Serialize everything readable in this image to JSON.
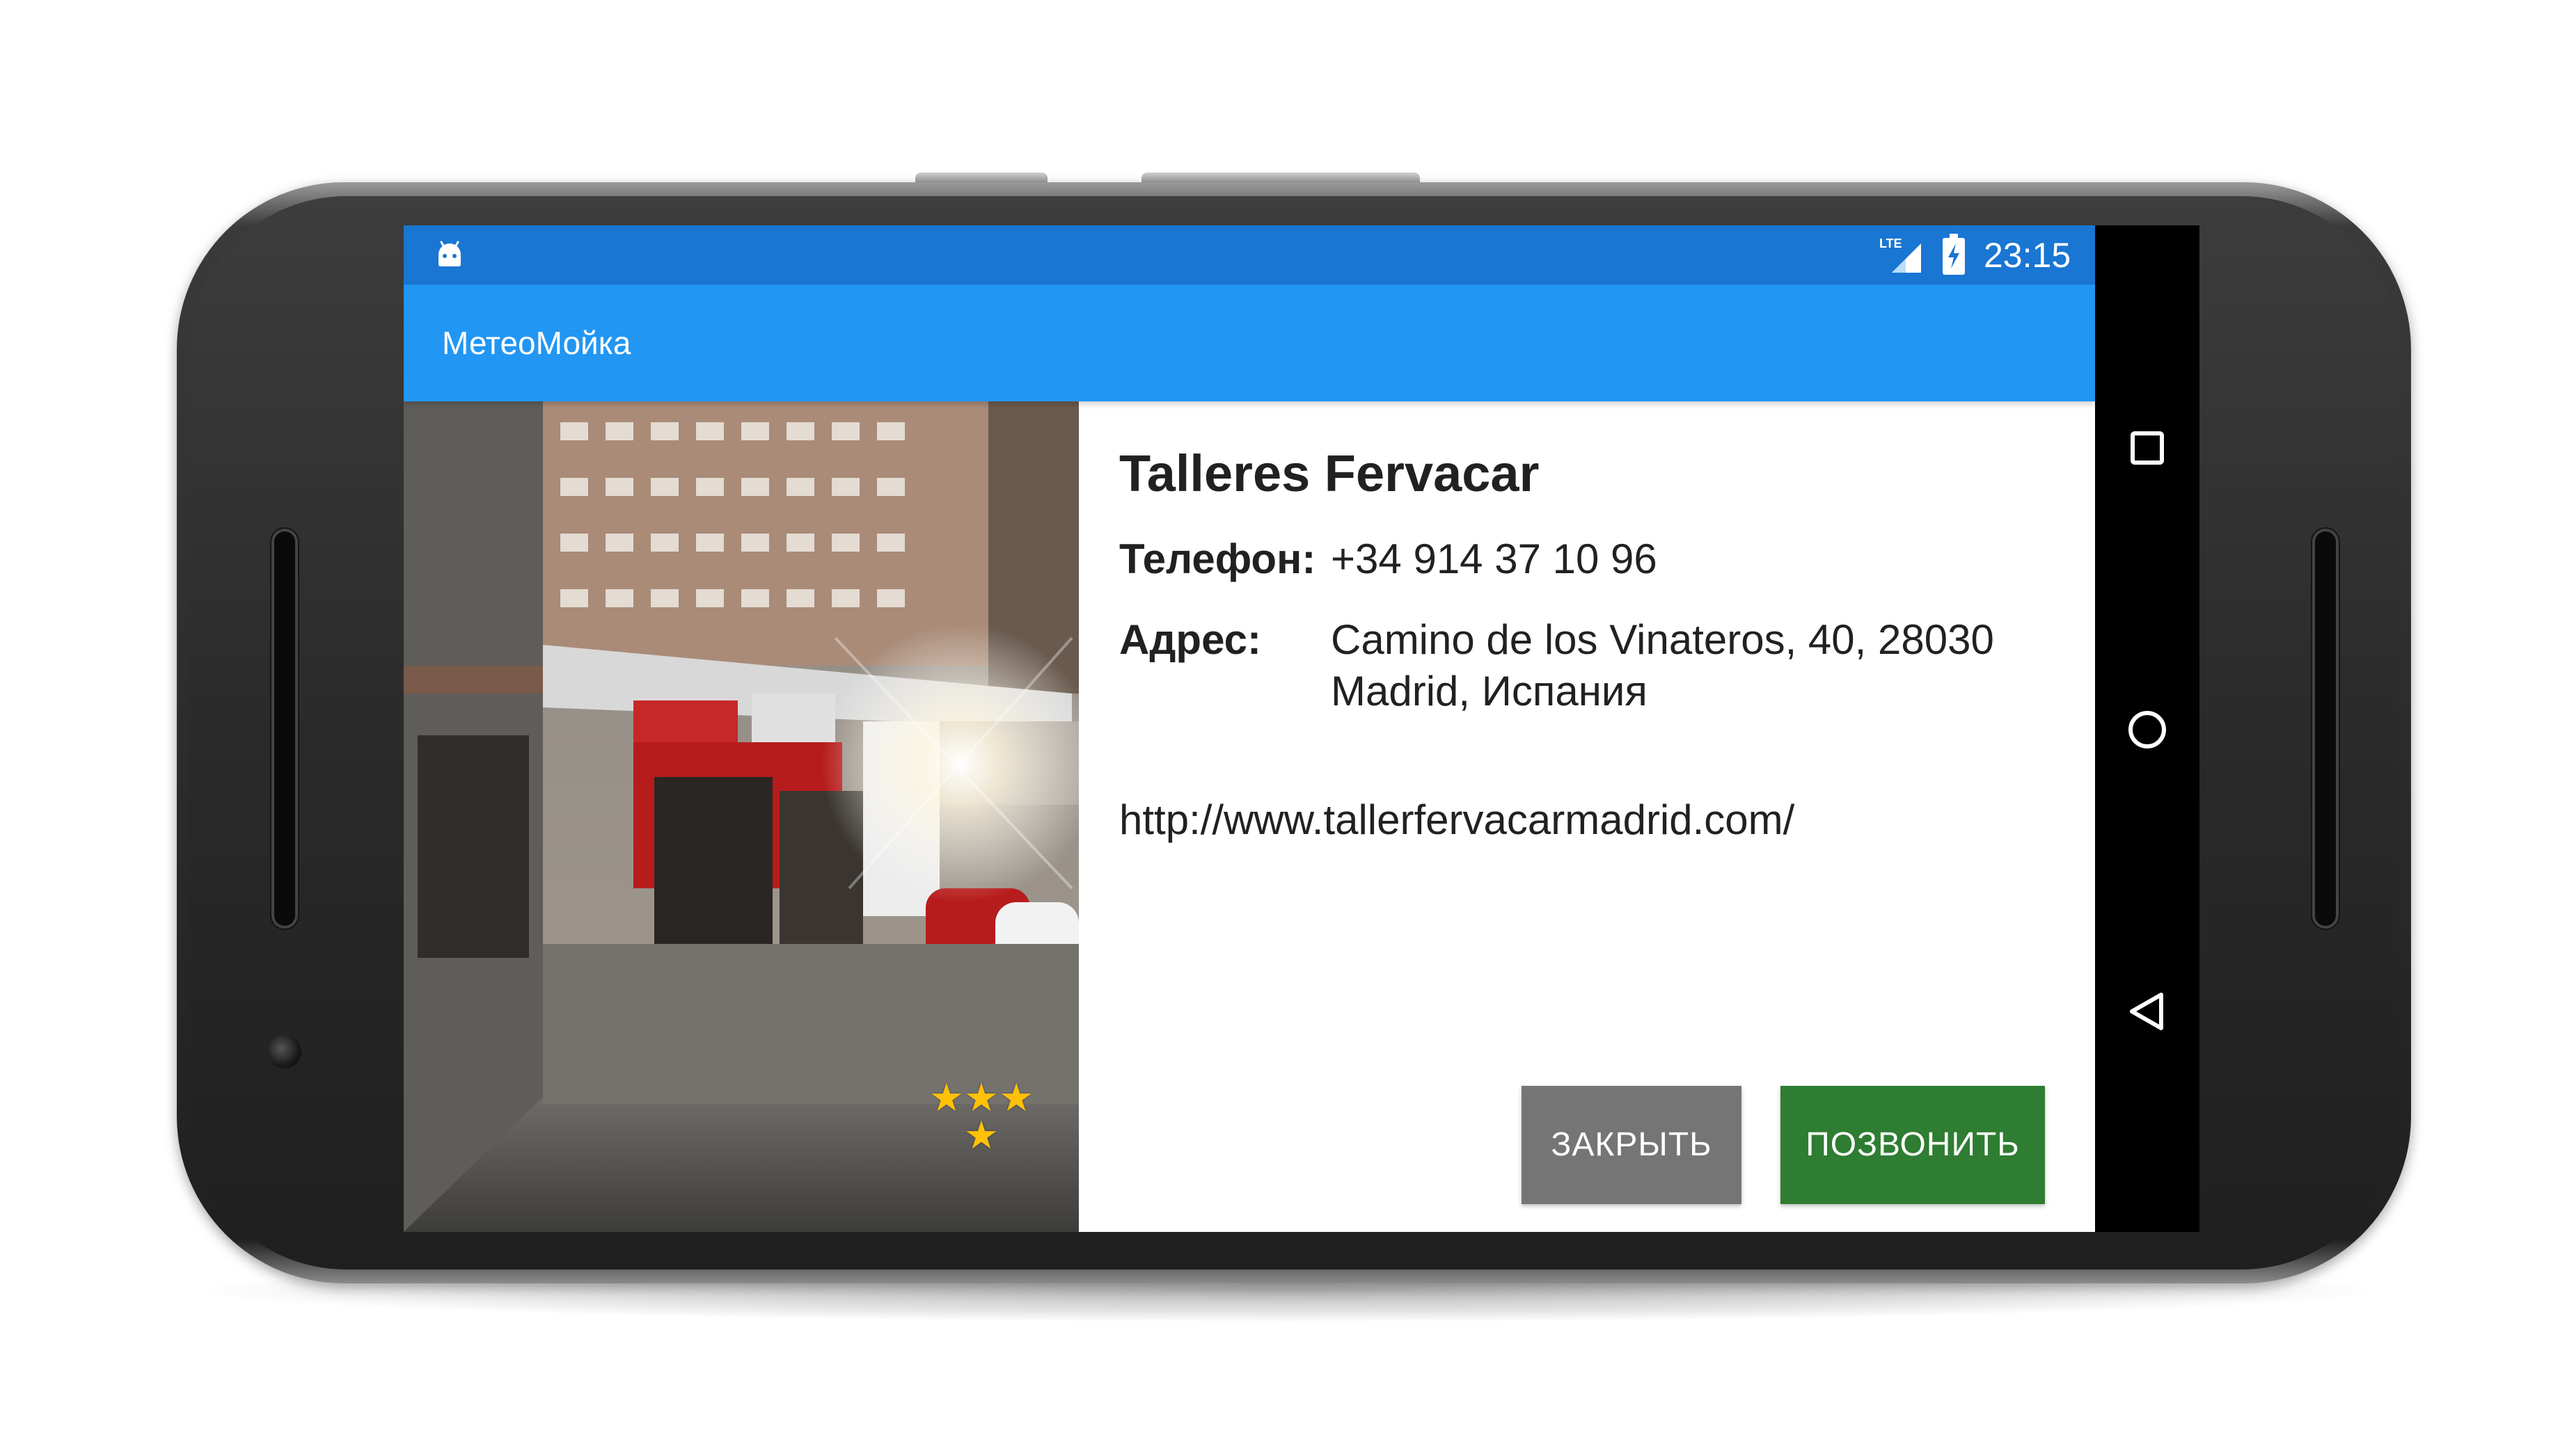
{
  "status_bar": {
    "notification_icon": "android-icon",
    "network_label": "LTE",
    "network_icon": "signal-icon",
    "battery_icon": "battery-charging-icon",
    "time": "23:15"
  },
  "app_bar": {
    "title": "МетеоМойка"
  },
  "place": {
    "photo_icon": "storefront-photo",
    "rating_stars": 4,
    "rating_glyphs": "★★★ ★",
    "name": "Talleres Fervacar",
    "phone_label": "Телефон:",
    "phone_value": "+34 914 37 10 96",
    "address_label": "Адрес:",
    "address_line1": "Camino de los Vinateros, 40, 28030",
    "address_line2": "Madrid, Испания",
    "website": "http://www.tallerfervacarmadrid.com/"
  },
  "actions": {
    "close_label": "ЗАКРЫТЬ",
    "call_label": "ПОЗВОНИТЬ"
  },
  "nav_bar": {
    "recent_icon": "recent-apps-icon",
    "home_icon": "home-icon",
    "back_icon": "back-icon"
  },
  "colors": {
    "status_bar": "#1976d2",
    "app_bar": "#2196f3",
    "close_button": "#757575",
    "call_button": "#2e7d32",
    "star": "#ffc107"
  }
}
